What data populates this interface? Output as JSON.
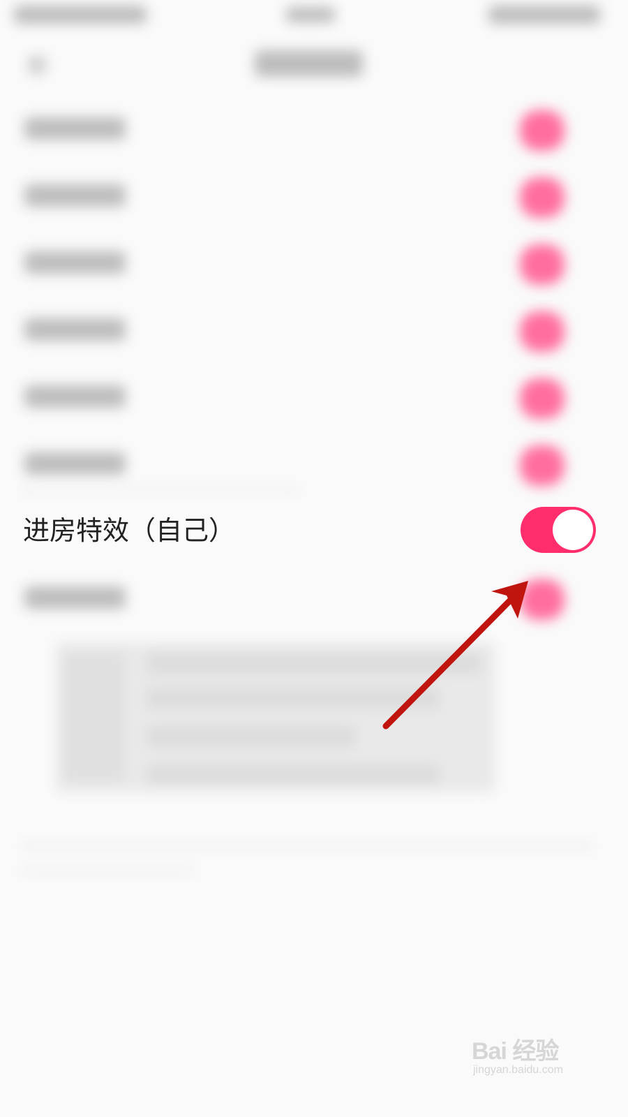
{
  "focused_setting": {
    "label": "进房特效（自己）",
    "toggle_state": "on"
  },
  "colors": {
    "toggle_on": "#ff2d6c",
    "toggle_knob": "#ffffff",
    "annotation_arrow": "#c0150f",
    "blurred_toggle": "#ff6e9e"
  },
  "watermark": {
    "main": "Bai 经验",
    "sub": "jingyan.baidu.com"
  }
}
